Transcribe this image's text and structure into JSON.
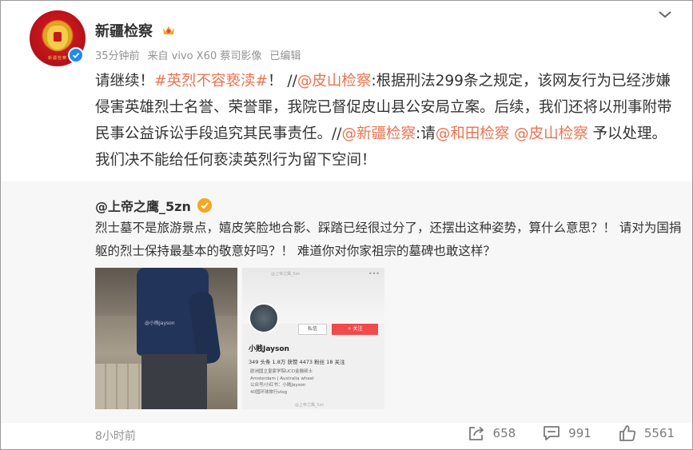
{
  "account": {
    "name": "新疆检察",
    "avatar_caption": "新疆检察"
  },
  "post": {
    "time_ago": "35分钟前",
    "source": "来自 vivo X60 蔡司影像",
    "edited": "已编辑",
    "segments": [
      {
        "text": "请继续！",
        "type": "text"
      },
      {
        "text": "#英烈不容亵渎#",
        "type": "link"
      },
      {
        "text": "！ //",
        "type": "text"
      },
      {
        "text": "@皮山检察",
        "type": "link"
      },
      {
        "text": ":根据刑法299条之规定，该网友行为已经涉嫌侵害英雄烈士名誉、荣誉罪，我院已督促皮山县公安局立案。后续，我们还将以刑事附带民事公益诉讼手段追究其民事责任。//",
        "type": "text"
      },
      {
        "text": "@新疆检察",
        "type": "link"
      },
      {
        "text": ":请",
        "type": "text"
      },
      {
        "text": "@和田检察",
        "type": "link"
      },
      {
        "text": " ",
        "type": "text"
      },
      {
        "text": "@皮山检察",
        "type": "link"
      },
      {
        "text": " 予以处理。我们决不能给任何亵渎英烈行为留下空间！",
        "type": "text"
      }
    ]
  },
  "retweet": {
    "author": "@上帝之鹰_5zn",
    "text": "烈士墓不是旅游景点，嬉皮笑脸地合影、踩踏已经很过分了，还摆出这种姿势，算什么意思？！ 请对为国捐躯的烈士保持最基本的敬意好吗？！ 难道你对你家祖宗的墓碑也敢这样？",
    "image1": {
      "watermark": "@小贱Jayson"
    },
    "image2": {
      "cover_watermark": "@上帝之鹰_5zn",
      "message_label": "私信",
      "follow_label": "+ 关注",
      "profile_name": "小贱Jayson",
      "stats": "349 头条   1.8万 获赞   4473 粉丝   18 关注",
      "info_lines": [
        "欧洲国立皇家学院UCD金融硕士",
        "Amsterdam | Australia wheel",
        "公众号/小红书：小贱Jayson",
        "40国环球旅行vlog"
      ],
      "bottom_watermark": "@上帝之鹰_5zn"
    }
  },
  "footer": {
    "time": "8小时前",
    "share_count": "658",
    "comment_count": "991",
    "like_count": "5561"
  },
  "colors": {
    "link": "#eb7350",
    "meta": "#939393",
    "retweet_bg": "#f7f7f7"
  }
}
